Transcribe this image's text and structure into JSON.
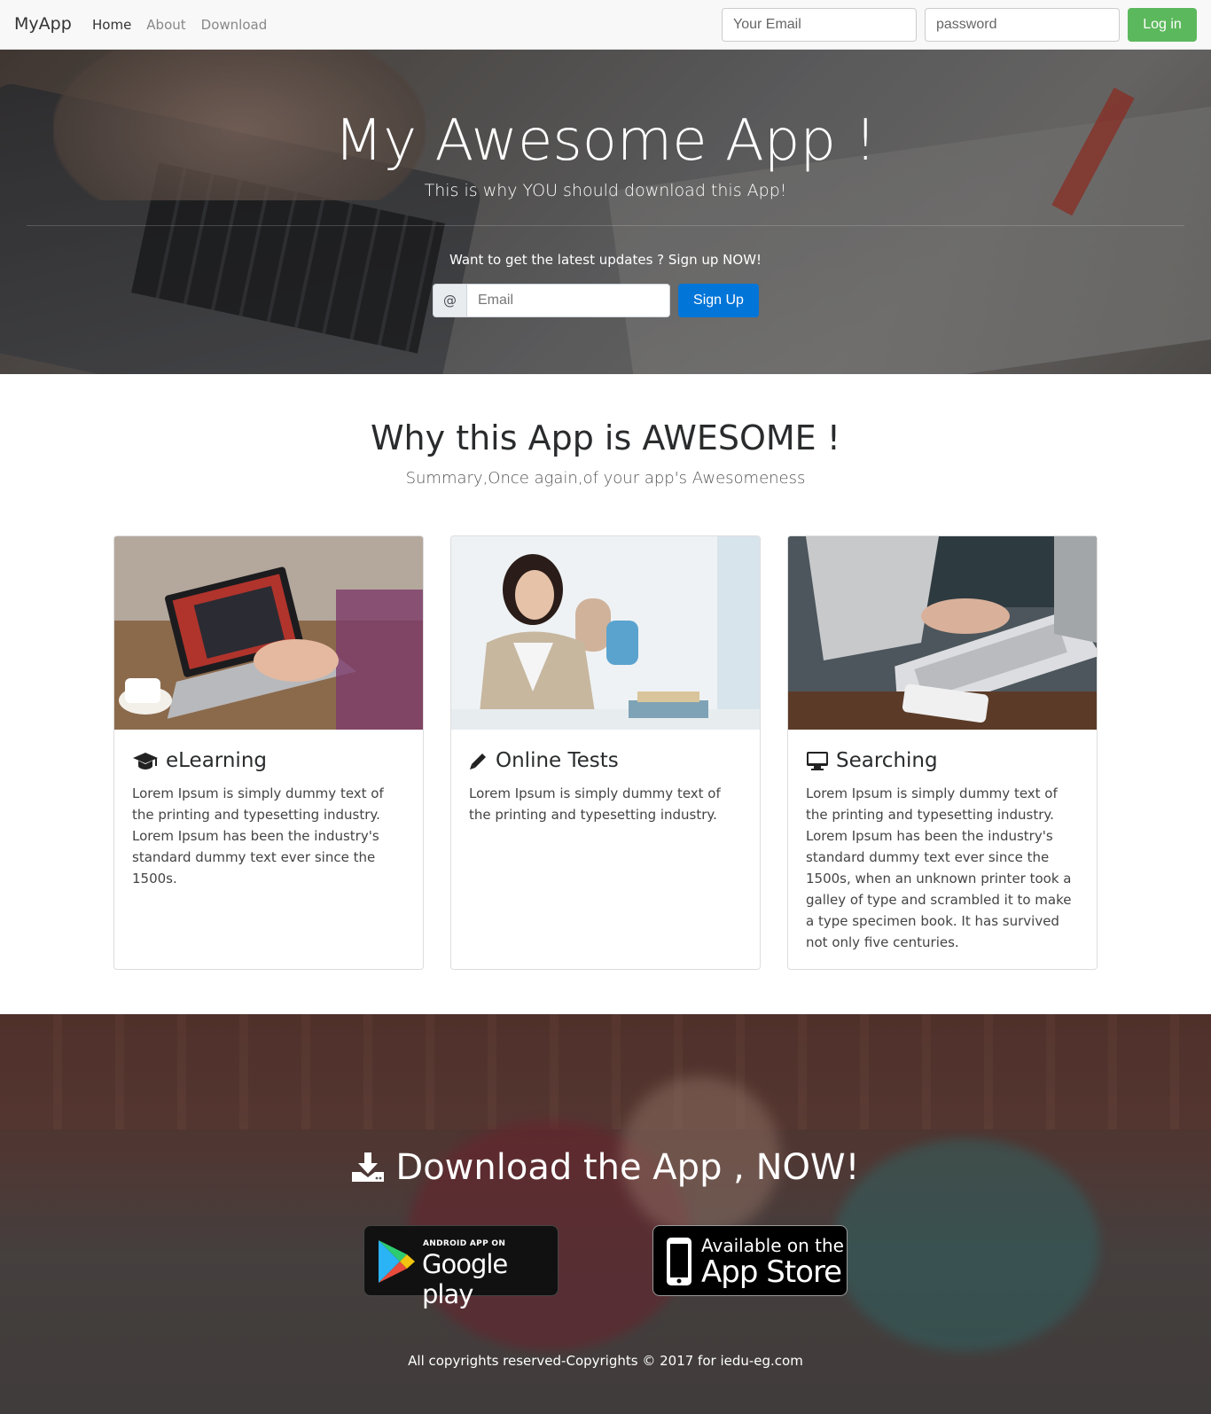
{
  "navbar": {
    "brand": "MyApp",
    "links": [
      "Home",
      "About",
      "Download"
    ],
    "email_placeholder": "Your Email",
    "password_placeholder": "password",
    "login_label": "Log in"
  },
  "hero": {
    "title": "My Awesome App !",
    "subtitle": "This is why YOU should download this App!",
    "cta": "Want to get the latest updates ? Sign up NOW!",
    "addon": "@",
    "email_placeholder": "Email",
    "signup_label": "Sign Up"
  },
  "features": {
    "title": "Why this App is AWESOME !",
    "subtitle": "Summary,Once again,of your app's Awesomeness",
    "cards": [
      {
        "icon": "graduation-cap-icon",
        "title": "eLearning",
        "text": "Lorem Ipsum is simply dummy text of the printing and typesetting industry. Lorem Ipsum has been the industry's standard dummy text ever since the 1500s."
      },
      {
        "icon": "pencil-icon",
        "title": "Online Tests",
        "text": "Lorem Ipsum is simply dummy text of the printing and typesetting industry."
      },
      {
        "icon": "desktop-icon",
        "title": "Searching",
        "text": "Lorem Ipsum is simply dummy text of the printing and typesetting industry. Lorem Ipsum has been the industry's standard dummy text ever since the 1500s, when an unknown printer took a galley of type and scrambled it to make a type specimen book. It has survived not only five centuries."
      }
    ]
  },
  "download": {
    "title": "Download the App , NOW!",
    "google_play_small": "ANDROID APP ON",
    "google_play_big": "Google play",
    "app_store_small": "Available on the",
    "app_store_big": "App Store",
    "copyright": "All copyrights reserved-Copyrights © 2017 for iedu-eg.com"
  },
  "colors": {
    "login_button": "#5cb85c",
    "signup_button": "#0275d8",
    "navbar_bg": "#f8f8f8"
  }
}
